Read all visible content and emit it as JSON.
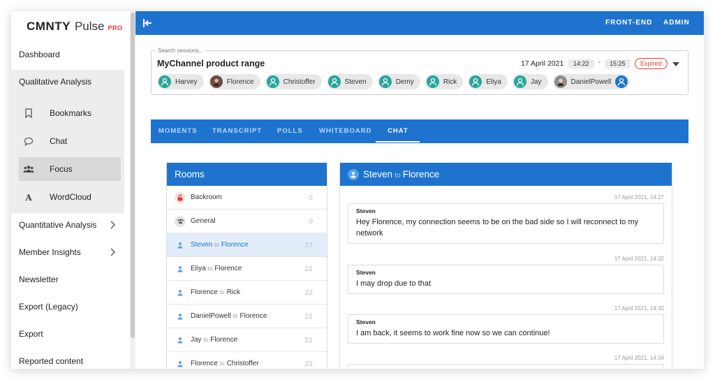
{
  "logo": {
    "brand": "CMNTY",
    "product": "Pulse",
    "tier": "PRO"
  },
  "sidebar": {
    "items": [
      {
        "label": "Dashboard"
      },
      {
        "label": "Qualitative Analysis"
      },
      {
        "label": "Quantitative Analysis"
      },
      {
        "label": "Member Insights"
      },
      {
        "label": "Newsletter"
      },
      {
        "label": "Export (Legacy)"
      },
      {
        "label": "Export"
      },
      {
        "label": "Reported content"
      }
    ],
    "sub_items": [
      {
        "label": "Bookmarks",
        "icon": "bookmark-icon"
      },
      {
        "label": "Chat",
        "icon": "chat-bubble-icon"
      },
      {
        "label": "Focus",
        "icon": "group-icon",
        "active": true
      },
      {
        "label": "WordCloud",
        "icon": "wordcloud-letter-icon"
      }
    ]
  },
  "topbar": {
    "frontend_label": "FRONT-END",
    "admin_label": "ADMIN"
  },
  "session": {
    "placeholder": "Search sessions...",
    "title": "MyChannel product range",
    "date": "17 April 2021",
    "start_time": "14:22",
    "separator": "-",
    "end_time": "15:25",
    "status": "Expired",
    "participants": [
      {
        "name": "Harvey",
        "avatar": "teal"
      },
      {
        "name": "Florence",
        "avatar": "photo"
      },
      {
        "name": "Christoffer",
        "avatar": "teal"
      },
      {
        "name": "Steven",
        "avatar": "teal"
      },
      {
        "name": "Demy",
        "avatar": "teal"
      },
      {
        "name": "Rick",
        "avatar": "teal"
      },
      {
        "name": "Eliya",
        "avatar": "teal"
      },
      {
        "name": "Jay",
        "avatar": "teal"
      },
      {
        "name": "DanielPowell",
        "avatar": "photo2"
      }
    ]
  },
  "tabs": [
    {
      "label": "MOMENTS"
    },
    {
      "label": "TRANSCRIPT"
    },
    {
      "label": "POLLS"
    },
    {
      "label": "WHITEBOARD"
    },
    {
      "label": "CHAT",
      "active": true
    }
  ],
  "rooms": {
    "title": "Rooms",
    "items": [
      {
        "from": "Backroom",
        "to": "",
        "count": "0",
        "icon": "lock-icon"
      },
      {
        "from": "General",
        "to": "",
        "count": "0",
        "icon": "group-icon"
      },
      {
        "from": "Steven",
        "to": "Florence",
        "count": "27",
        "icon": "person-icon",
        "active": true
      },
      {
        "from": "Eliya",
        "to": "Florence",
        "count": "21",
        "icon": "person-icon"
      },
      {
        "from": "Florence",
        "to": "Rick",
        "count": "22",
        "icon": "person-icon"
      },
      {
        "from": "DanielPowell",
        "to": "Florence",
        "count": "21",
        "icon": "person-icon"
      },
      {
        "from": "Jay",
        "to": "Florence",
        "count": "21",
        "icon": "person-icon"
      },
      {
        "from": "Florence",
        "to": "Christoffer",
        "count": "21",
        "icon": "person-icon"
      }
    ],
    "to_word": "to"
  },
  "chat": {
    "from": "Steven",
    "to_word": "to",
    "to": "Florence",
    "messages": [
      {
        "time": "17 April 2021, 14:27",
        "author": "Steven",
        "text": "Hey Florence, my connection seems to be on the bad side so I will reconnect to my network"
      },
      {
        "time": "17 April 2021, 14:32",
        "author": "Steven",
        "text": "I may drop due to that"
      },
      {
        "time": "17 April 2021, 14:32",
        "author": "Steven",
        "text": "I am back, it seems to work fine now so we can continue!"
      },
      {
        "time": "17 April 2021, 14:34",
        "author": "",
        "text": ""
      }
    ]
  },
  "colors": {
    "primary": "#1e73cf",
    "expired": "#e53935",
    "avatar_teal": "#26a69a"
  }
}
